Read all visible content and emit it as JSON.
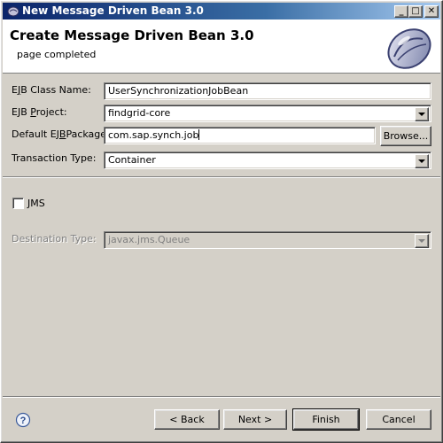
{
  "window": {
    "title": "New Message Driven Bean 3.0",
    "minimize": "_",
    "maximize": "□",
    "close": "✕"
  },
  "banner": {
    "title": "Create Message Driven Bean 3.0",
    "message": "page completed",
    "image_icon": "bean-wizard-icon"
  },
  "form": {
    "ejb_class_name": {
      "label": "EJB Class Name:",
      "value": "UserSynchronizationJobBean"
    },
    "ejb_project": {
      "label": "EJB Project:",
      "value": "findgrid-core"
    },
    "default_package": {
      "label": "Default EJBPackage:",
      "value": "com.sap.synch.job",
      "browse_label": "Browse..."
    },
    "transaction_type": {
      "label": "Transaction Type:",
      "value": "Container"
    },
    "jms": {
      "label": "JMS",
      "checked": false
    },
    "destination_type": {
      "label": "Destination Type:",
      "value": "javax.jms.Queue",
      "enabled": false
    }
  },
  "buttons": {
    "back": "< Back",
    "next": "Next >",
    "finish": "Finish",
    "cancel": "Cancel"
  },
  "icons": {
    "help": "help-icon",
    "window": "bean-icon"
  }
}
